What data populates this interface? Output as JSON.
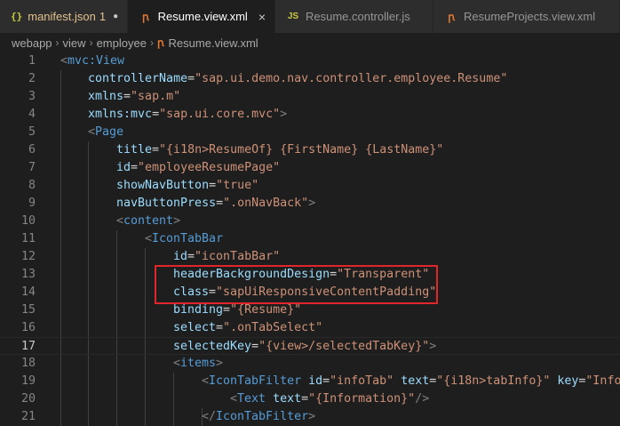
{
  "tabs": [
    {
      "label": "manifest.json",
      "count": "1",
      "icon": "json-icon",
      "modified": true
    },
    {
      "label": "Resume.view.xml",
      "icon": "rss-icon",
      "active": true
    },
    {
      "label": "Resume.controller.js",
      "icon": "js-icon"
    },
    {
      "label": "ResumeProjects.view.xml",
      "icon": "rss-icon"
    }
  ],
  "tab_icons": {
    "json": "{}",
    "js": "JS",
    "rss": "ꞃ"
  },
  "breadcrumb": {
    "items": [
      "webapp",
      "view",
      "employee"
    ],
    "file": "Resume.view.xml"
  },
  "editor": {
    "lines": [
      {
        "n": "1",
        "tokens": [
          [
            "p",
            "<"
          ],
          [
            "g",
            "mvc:View"
          ]
        ]
      },
      {
        "n": "2",
        "tokens": [
          [
            "a",
            "controllerName"
          ],
          [
            "e",
            "="
          ],
          [
            "s",
            "\"sap.ui.demo.nav.controller.employee.Resume\""
          ]
        ]
      },
      {
        "n": "3",
        "tokens": [
          [
            "a",
            "xmlns"
          ],
          [
            "e",
            "="
          ],
          [
            "s",
            "\"sap.m\""
          ]
        ]
      },
      {
        "n": "4",
        "tokens": [
          [
            "a",
            "xmlns:mvc"
          ],
          [
            "e",
            "="
          ],
          [
            "s",
            "\"sap.ui.core.mvc\""
          ],
          [
            "p",
            ">"
          ]
        ]
      },
      {
        "n": "5",
        "tokens": [
          [
            "p",
            "<"
          ],
          [
            "g",
            "Page"
          ]
        ]
      },
      {
        "n": "6",
        "tokens": [
          [
            "a",
            "title"
          ],
          [
            "e",
            "="
          ],
          [
            "s",
            "\"{i18n>ResumeOf} {FirstName} {LastName}\""
          ]
        ]
      },
      {
        "n": "7",
        "tokens": [
          [
            "a",
            "id"
          ],
          [
            "e",
            "="
          ],
          [
            "s",
            "\"employeeResumePage\""
          ]
        ]
      },
      {
        "n": "8",
        "tokens": [
          [
            "a",
            "showNavButton"
          ],
          [
            "e",
            "="
          ],
          [
            "s",
            "\"true\""
          ]
        ]
      },
      {
        "n": "9",
        "tokens": [
          [
            "a",
            "navButtonPress"
          ],
          [
            "e",
            "="
          ],
          [
            "s",
            "\".onNavBack\""
          ],
          [
            "p",
            ">"
          ]
        ]
      },
      {
        "n": "10",
        "tokens": [
          [
            "p",
            "<"
          ],
          [
            "g",
            "content"
          ],
          [
            "p",
            ">"
          ]
        ]
      },
      {
        "n": "11",
        "tokens": [
          [
            "p",
            "<"
          ],
          [
            "g",
            "IconTabBar"
          ]
        ]
      },
      {
        "n": "12",
        "tokens": [
          [
            "a",
            "id"
          ],
          [
            "e",
            "="
          ],
          [
            "s",
            "\"iconTabBar\""
          ]
        ]
      },
      {
        "n": "13",
        "tokens": [
          [
            "a",
            "headerBackgroundDesign"
          ],
          [
            "e",
            "="
          ],
          [
            "s",
            "\"Transparent\""
          ]
        ]
      },
      {
        "n": "14",
        "tokens": [
          [
            "a",
            "class"
          ],
          [
            "e",
            "="
          ],
          [
            "s",
            "\"sapUiResponsiveContentPadding\""
          ]
        ]
      },
      {
        "n": "15",
        "tokens": [
          [
            "a",
            "binding"
          ],
          [
            "e",
            "="
          ],
          [
            "s",
            "\"{Resume}\""
          ]
        ]
      },
      {
        "n": "16",
        "tokens": [
          [
            "a",
            "select"
          ],
          [
            "e",
            "="
          ],
          [
            "s",
            "\".onTabSelect\""
          ]
        ]
      },
      {
        "n": "17",
        "tokens": [
          [
            "a",
            "selectedKey"
          ],
          [
            "e",
            "="
          ],
          [
            "s",
            "\"{view>/selectedTabKey}\""
          ],
          [
            "p",
            ">"
          ]
        ]
      },
      {
        "n": "18",
        "tokens": [
          [
            "p",
            "<"
          ],
          [
            "g",
            "items"
          ],
          [
            "p",
            ">"
          ]
        ]
      },
      {
        "n": "19",
        "tokens": [
          [
            "p",
            "<"
          ],
          [
            "g",
            "IconTabFilter"
          ],
          [
            "e",
            " "
          ],
          [
            "a",
            "id"
          ],
          [
            "e",
            "="
          ],
          [
            "s",
            "\"infoTab\""
          ],
          [
            "e",
            " "
          ],
          [
            "a",
            "text"
          ],
          [
            "e",
            "="
          ],
          [
            "s",
            "\"{i18n>tabInfo}\""
          ],
          [
            "e",
            " "
          ],
          [
            "a",
            "key"
          ],
          [
            "e",
            "="
          ],
          [
            "s",
            "\"Info"
          ]
        ]
      },
      {
        "n": "20",
        "tokens": [
          [
            "p",
            "<"
          ],
          [
            "g",
            "Text"
          ],
          [
            "e",
            " "
          ],
          [
            "a",
            "text"
          ],
          [
            "e",
            "="
          ],
          [
            "s",
            "\"{Information}\""
          ],
          [
            "p",
            "/>"
          ]
        ]
      },
      {
        "n": "21",
        "tokens": [
          [
            "p",
            "</"
          ],
          [
            "g",
            "IconTabFilter"
          ],
          [
            "p",
            ">"
          ]
        ]
      }
    ],
    "current_line": "17",
    "highlighted_lines": [
      "16",
      "17"
    ]
  },
  "colors": {
    "background": "#1e1e1e",
    "tag": "#569cd6",
    "attribute": "#9cdcfe",
    "string": "#ce9178",
    "punctuation": "#808080",
    "highlight_box": "#e0262b"
  }
}
